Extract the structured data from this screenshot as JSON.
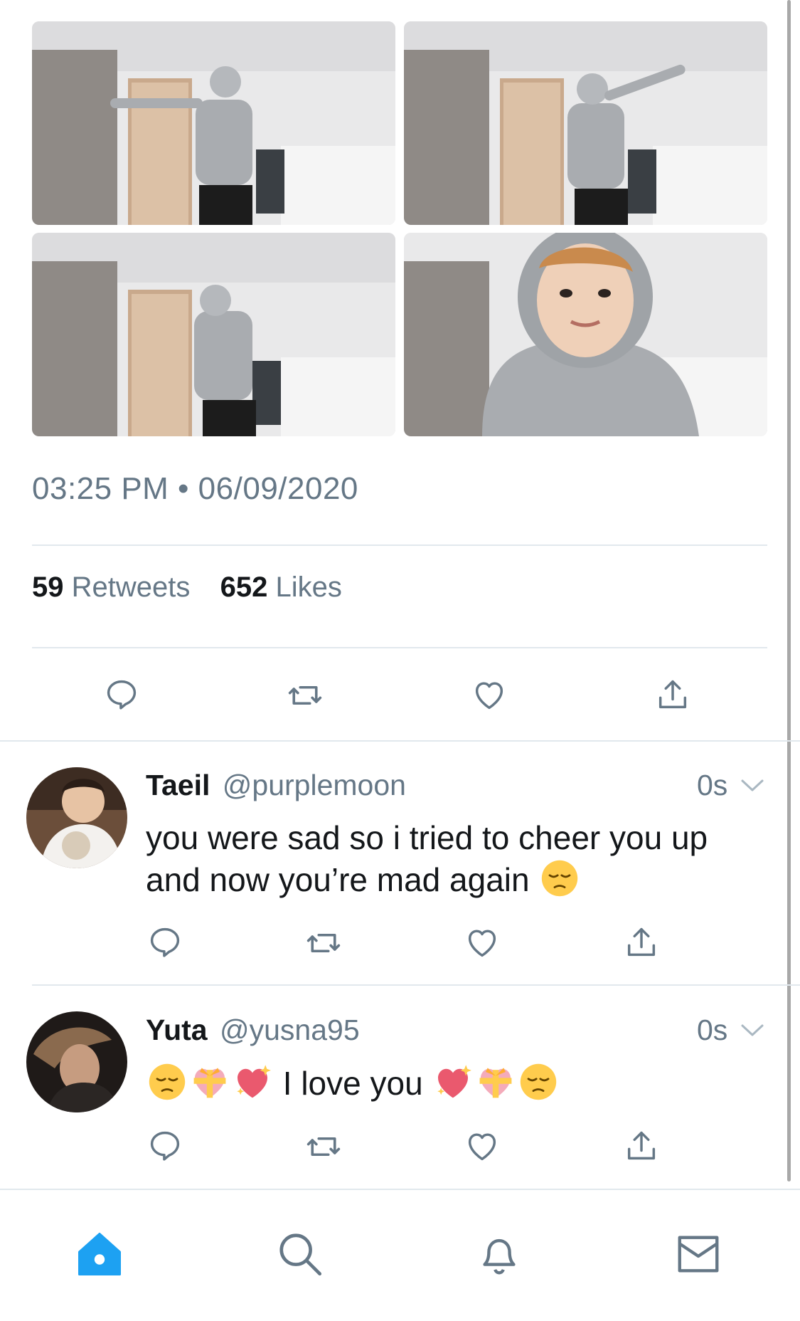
{
  "tweet": {
    "photos": [
      "photo-1",
      "photo-2",
      "photo-3",
      "photo-4"
    ],
    "timestamp": "03:25 PM • 06/09/2020",
    "retweets_count": "59",
    "retweets_label": "Retweets",
    "likes_count": "652",
    "likes_label": "Likes",
    "actions": [
      "reply-icon",
      "retweet-icon",
      "like-icon",
      "share-icon"
    ]
  },
  "replies": [
    {
      "display_name": "Taeil",
      "handle": "@purplemoon",
      "time": "0s",
      "text": "you were sad so i tried to cheer you up and now you’re mad again",
      "emojis": [
        "pensive-face"
      ]
    },
    {
      "display_name": "Yuta",
      "handle": "@yusna95",
      "time": "0s",
      "text": "I love you",
      "emojis_before": [
        "pensive-face",
        "heart-with-ribbon",
        "sparkling-heart"
      ],
      "emojis_after": [
        "sparkling-heart",
        "heart-with-ribbon",
        "pensive-face"
      ]
    }
  ],
  "tabbar": {
    "tabs": [
      "home-icon",
      "search-icon",
      "notifications-icon",
      "messages-icon"
    ],
    "active": "home-icon"
  },
  "colors": {
    "accent": "#1da1f2",
    "icon_gray": "#657786",
    "divider": "#e1e8ed",
    "text": "#14171a"
  }
}
